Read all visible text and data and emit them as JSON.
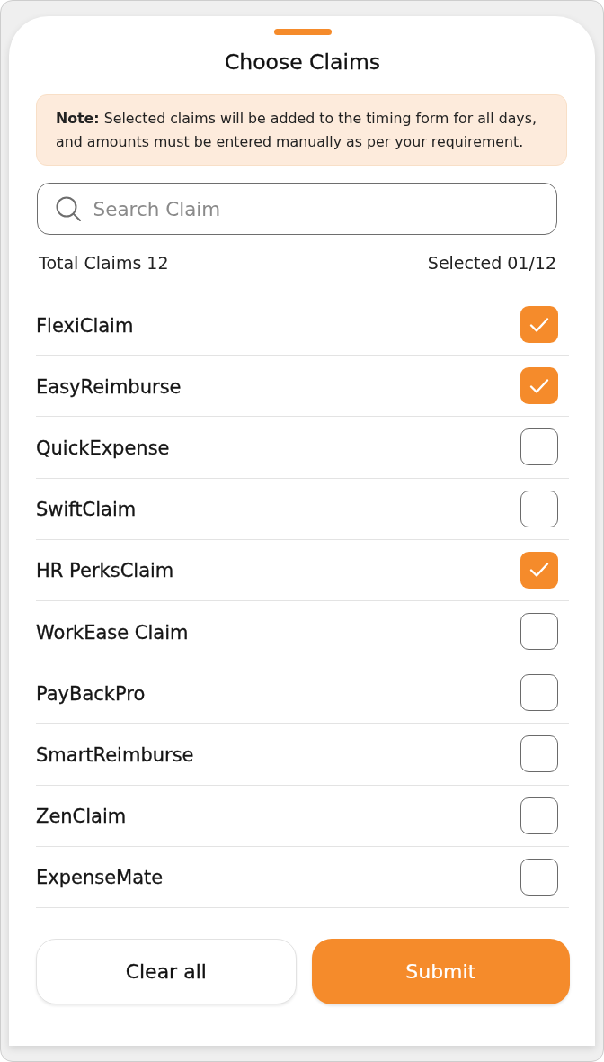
{
  "sheet": {
    "title": "Choose Claims"
  },
  "note": {
    "text": "**Note:** Selected claims will be added to the timing form for all days, and amounts must be entered manually as per your requirement."
  },
  "search": {
    "placeholder": "Search Claim"
  },
  "summary": {
    "total": "Total Claims 12",
    "selected": "Selected 01/12"
  },
  "claims": [
    {
      "name": "FlexiClaim",
      "checked": true
    },
    {
      "name": "EasyReimburse",
      "checked": true
    },
    {
      "name": "QuickExpense",
      "checked": false
    },
    {
      "name": "SwiftClaim",
      "checked": false
    },
    {
      "name": "HR PerksClaim",
      "checked": true
    },
    {
      "name": "WorkEase Claim",
      "checked": false
    },
    {
      "name": "PayBackPro",
      "checked": false
    },
    {
      "name": "SmartReimburse",
      "checked": false
    },
    {
      "name": "ZenClaim",
      "checked": false
    },
    {
      "name": "ExpenseMate",
      "checked": false
    }
  ],
  "buttons": [
    {
      "label": "Clear all",
      "kind": "secondary"
    },
    {
      "label": "Submit",
      "kind": "primary"
    }
  ]
}
